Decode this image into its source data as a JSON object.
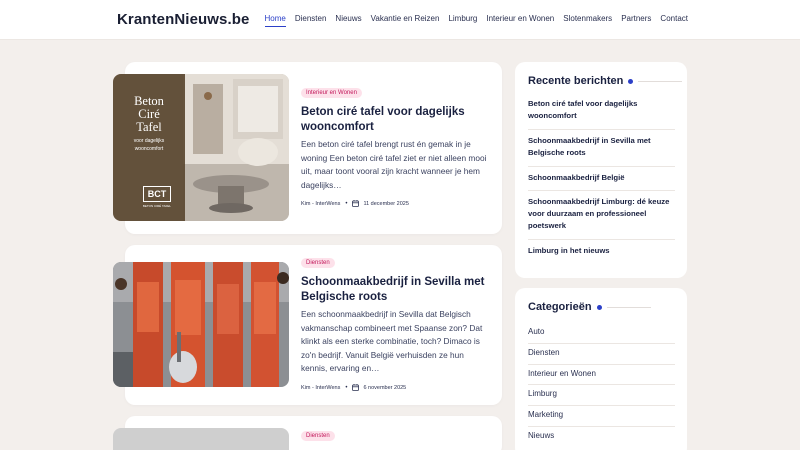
{
  "header": {
    "logo": "KrantenNieuws.be",
    "nav": [
      "Home",
      "Diensten",
      "Nieuws",
      "Vakantie en Reizen",
      "Limburg",
      "Interieur en Wonen",
      "Slotenmakers",
      "Partners",
      "Contact"
    ]
  },
  "posts": [
    {
      "badge": "Interieur en Wonen",
      "title": "Beton ciré tafel voor dagelijks wooncomfort",
      "excerpt": "Een beton ciré tafel brengt rust én gemak in je woning Een beton ciré tafel ziet er niet alleen mooi uit, maar toont vooral zijn kracht wanneer je hem dagelijks…",
      "author": "Kim - InterWens",
      "date": "11 december 2025",
      "image": {
        "title_lines": [
          "Beton",
          "Ciré",
          "Tafel"
        ],
        "subtitle_lines": [
          "voor dagelijks",
          "wooncomfort"
        ],
        "logo": "BCT",
        "logo_sub": "BETON CIRÉ TAFEL"
      }
    },
    {
      "badge": "Diensten",
      "title": "Schoonmaakbedrijf in Sevilla met Belgische roots",
      "excerpt": "Een schoonmaakbedrijf in Sevilla dat Belgisch vakmanschap combineert met Spaanse zon? Dat klinkt als een sterke combinatie, toch? Dimaco is zo'n bedrijf. Vanuit België verhuisden ze hun kennis, ervaring en…",
      "author": "Kim - InterWens",
      "date": "6 november 2025"
    },
    {
      "badge": "Diensten"
    }
  ],
  "sidebar": {
    "recent": {
      "title": "Recente berichten",
      "items": [
        "Beton ciré tafel voor dagelijks wooncomfort",
        "Schoonmaakbedrijf in Sevilla met Belgische roots",
        "Schoonmaakbedrijf België",
        "Schoonmaakbedrijf Limburg: dé keuze voor duurzaam en professioneel poetswerk",
        "Limburg in het nieuws"
      ]
    },
    "categories": {
      "title": "Categorieën",
      "items": [
        "Auto",
        "Diensten",
        "Interieur en Wonen",
        "Limburg",
        "Marketing",
        "Nieuws"
      ]
    }
  },
  "colors": {
    "accent": "#2c40c8",
    "badge_bg": "#fde1ea",
    "badge_text": "#c2185b",
    "page_bg": "#f3efec"
  }
}
